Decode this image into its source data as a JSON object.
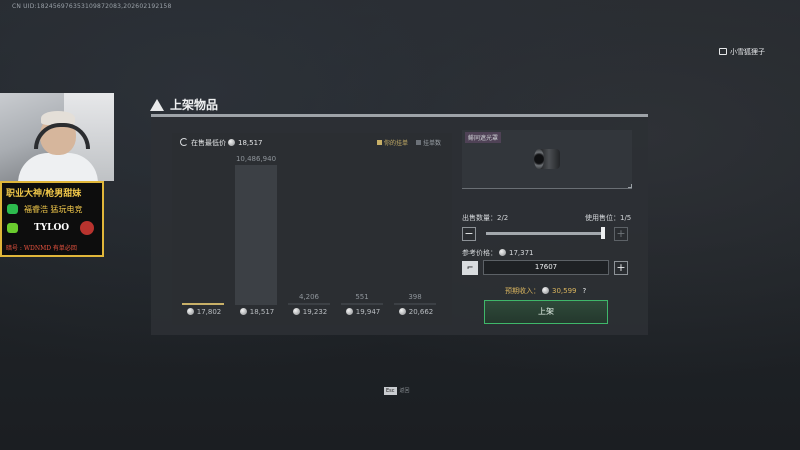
{
  "overlay": {
    "uid": "CN UID:182456976353109872083,202602192158",
    "player_tag": "小雪狐狸子"
  },
  "sponsor": {
    "line1": "职业大神/枪男甜妹",
    "line2": "福睿浩 猛玩电竞",
    "line3": "TYLOO",
    "line4": "暗号 : WDNMD 有单必回"
  },
  "dialog": {
    "title": "上架物品"
  },
  "chart_header": {
    "lowest_label": "在售最低价",
    "lowest_value": "18,517",
    "legend_mine": "你的挂单",
    "legend_all": "挂单数"
  },
  "chart_data": {
    "type": "bar",
    "categories": [
      "17,802",
      "18,517",
      "19,232",
      "19,947",
      "20,662"
    ],
    "series": [
      {
        "name": "挂单数",
        "values": [
          null,
          10486940,
          4206,
          551,
          398
        ]
      }
    ],
    "value_labels": [
      "",
      "10,486,940",
      "4,206",
      "551",
      "398"
    ],
    "mine_index": 0,
    "mine_fraction": 0.008,
    "colors": {
      "mine": "#c8b068",
      "bar": "#3c4045"
    }
  },
  "item": {
    "name": "鲱同遮光罩"
  },
  "sell": {
    "qty_label": "出售数量：",
    "qty_value": "2/2",
    "slots_label": "使用售位：",
    "slots_value": "1/5",
    "minus": "−",
    "plus": "+",
    "ref_price_label": "参考价格：",
    "ref_price_value": "17,371",
    "price_input": "17607",
    "income_label": "预期收入：",
    "income_value": "30,599",
    "help": "?",
    "list_button": "上架"
  },
  "footer": {
    "esc_key": "Esc",
    "esc_label": "返回"
  }
}
